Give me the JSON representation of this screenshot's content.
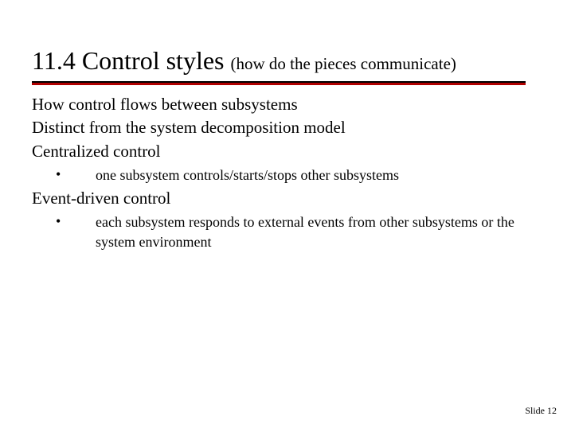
{
  "title": {
    "main": "11.4 Control styles ",
    "sub": "(how do the pieces communicate)"
  },
  "lines": {
    "l1": "How control flows between subsystems",
    "l2": "Distinct from the system decomposition model",
    "l3": "Centralized control",
    "b1": "one subsystem controls/starts/stops other subsystems",
    "l4": "Event-driven control",
    "b2": "each subsystem responds to external events from other subsystems or the system environment"
  },
  "footer": "Slide 12",
  "glyphs": {
    "bullet": "•"
  }
}
